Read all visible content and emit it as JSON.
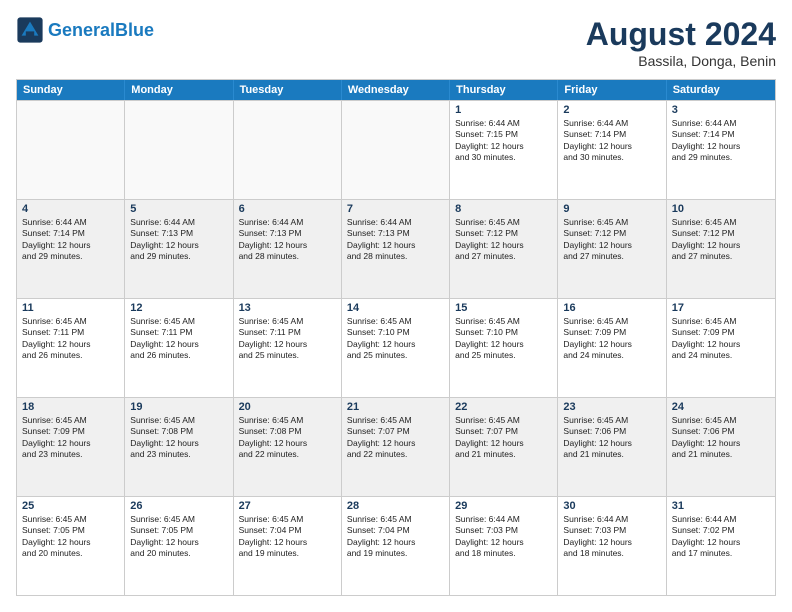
{
  "logo": {
    "text_general": "General",
    "text_blue": "Blue"
  },
  "header": {
    "month_title": "August 2024",
    "subtitle": "Bassila, Donga, Benin"
  },
  "weekdays": [
    "Sunday",
    "Monday",
    "Tuesday",
    "Wednesday",
    "Thursday",
    "Friday",
    "Saturday"
  ],
  "rows": [
    [
      {
        "day": "",
        "text": "",
        "empty": true
      },
      {
        "day": "",
        "text": "",
        "empty": true
      },
      {
        "day": "",
        "text": "",
        "empty": true
      },
      {
        "day": "",
        "text": "",
        "empty": true
      },
      {
        "day": "1",
        "text": "Sunrise: 6:44 AM\nSunset: 7:15 PM\nDaylight: 12 hours\nand 30 minutes.",
        "empty": false
      },
      {
        "day": "2",
        "text": "Sunrise: 6:44 AM\nSunset: 7:14 PM\nDaylight: 12 hours\nand 30 minutes.",
        "empty": false
      },
      {
        "day": "3",
        "text": "Sunrise: 6:44 AM\nSunset: 7:14 PM\nDaylight: 12 hours\nand 29 minutes.",
        "empty": false
      }
    ],
    [
      {
        "day": "4",
        "text": "Sunrise: 6:44 AM\nSunset: 7:14 PM\nDaylight: 12 hours\nand 29 minutes.",
        "empty": false
      },
      {
        "day": "5",
        "text": "Sunrise: 6:44 AM\nSunset: 7:13 PM\nDaylight: 12 hours\nand 29 minutes.",
        "empty": false
      },
      {
        "day": "6",
        "text": "Sunrise: 6:44 AM\nSunset: 7:13 PM\nDaylight: 12 hours\nand 28 minutes.",
        "empty": false
      },
      {
        "day": "7",
        "text": "Sunrise: 6:44 AM\nSunset: 7:13 PM\nDaylight: 12 hours\nand 28 minutes.",
        "empty": false
      },
      {
        "day": "8",
        "text": "Sunrise: 6:45 AM\nSunset: 7:12 PM\nDaylight: 12 hours\nand 27 minutes.",
        "empty": false
      },
      {
        "day": "9",
        "text": "Sunrise: 6:45 AM\nSunset: 7:12 PM\nDaylight: 12 hours\nand 27 minutes.",
        "empty": false
      },
      {
        "day": "10",
        "text": "Sunrise: 6:45 AM\nSunset: 7:12 PM\nDaylight: 12 hours\nand 27 minutes.",
        "empty": false
      }
    ],
    [
      {
        "day": "11",
        "text": "Sunrise: 6:45 AM\nSunset: 7:11 PM\nDaylight: 12 hours\nand 26 minutes.",
        "empty": false
      },
      {
        "day": "12",
        "text": "Sunrise: 6:45 AM\nSunset: 7:11 PM\nDaylight: 12 hours\nand 26 minutes.",
        "empty": false
      },
      {
        "day": "13",
        "text": "Sunrise: 6:45 AM\nSunset: 7:11 PM\nDaylight: 12 hours\nand 25 minutes.",
        "empty": false
      },
      {
        "day": "14",
        "text": "Sunrise: 6:45 AM\nSunset: 7:10 PM\nDaylight: 12 hours\nand 25 minutes.",
        "empty": false
      },
      {
        "day": "15",
        "text": "Sunrise: 6:45 AM\nSunset: 7:10 PM\nDaylight: 12 hours\nand 25 minutes.",
        "empty": false
      },
      {
        "day": "16",
        "text": "Sunrise: 6:45 AM\nSunset: 7:09 PM\nDaylight: 12 hours\nand 24 minutes.",
        "empty": false
      },
      {
        "day": "17",
        "text": "Sunrise: 6:45 AM\nSunset: 7:09 PM\nDaylight: 12 hours\nand 24 minutes.",
        "empty": false
      }
    ],
    [
      {
        "day": "18",
        "text": "Sunrise: 6:45 AM\nSunset: 7:09 PM\nDaylight: 12 hours\nand 23 minutes.",
        "empty": false
      },
      {
        "day": "19",
        "text": "Sunrise: 6:45 AM\nSunset: 7:08 PM\nDaylight: 12 hours\nand 23 minutes.",
        "empty": false
      },
      {
        "day": "20",
        "text": "Sunrise: 6:45 AM\nSunset: 7:08 PM\nDaylight: 12 hours\nand 22 minutes.",
        "empty": false
      },
      {
        "day": "21",
        "text": "Sunrise: 6:45 AM\nSunset: 7:07 PM\nDaylight: 12 hours\nand 22 minutes.",
        "empty": false
      },
      {
        "day": "22",
        "text": "Sunrise: 6:45 AM\nSunset: 7:07 PM\nDaylight: 12 hours\nand 21 minutes.",
        "empty": false
      },
      {
        "day": "23",
        "text": "Sunrise: 6:45 AM\nSunset: 7:06 PM\nDaylight: 12 hours\nand 21 minutes.",
        "empty": false
      },
      {
        "day": "24",
        "text": "Sunrise: 6:45 AM\nSunset: 7:06 PM\nDaylight: 12 hours\nand 21 minutes.",
        "empty": false
      }
    ],
    [
      {
        "day": "25",
        "text": "Sunrise: 6:45 AM\nSunset: 7:05 PM\nDaylight: 12 hours\nand 20 minutes.",
        "empty": false
      },
      {
        "day": "26",
        "text": "Sunrise: 6:45 AM\nSunset: 7:05 PM\nDaylight: 12 hours\nand 20 minutes.",
        "empty": false
      },
      {
        "day": "27",
        "text": "Sunrise: 6:45 AM\nSunset: 7:04 PM\nDaylight: 12 hours\nand 19 minutes.",
        "empty": false
      },
      {
        "day": "28",
        "text": "Sunrise: 6:45 AM\nSunset: 7:04 PM\nDaylight: 12 hours\nand 19 minutes.",
        "empty": false
      },
      {
        "day": "29",
        "text": "Sunrise: 6:44 AM\nSunset: 7:03 PM\nDaylight: 12 hours\nand 18 minutes.",
        "empty": false
      },
      {
        "day": "30",
        "text": "Sunrise: 6:44 AM\nSunset: 7:03 PM\nDaylight: 12 hours\nand 18 minutes.",
        "empty": false
      },
      {
        "day": "31",
        "text": "Sunrise: 6:44 AM\nSunset: 7:02 PM\nDaylight: 12 hours\nand 17 minutes.",
        "empty": false
      }
    ]
  ]
}
